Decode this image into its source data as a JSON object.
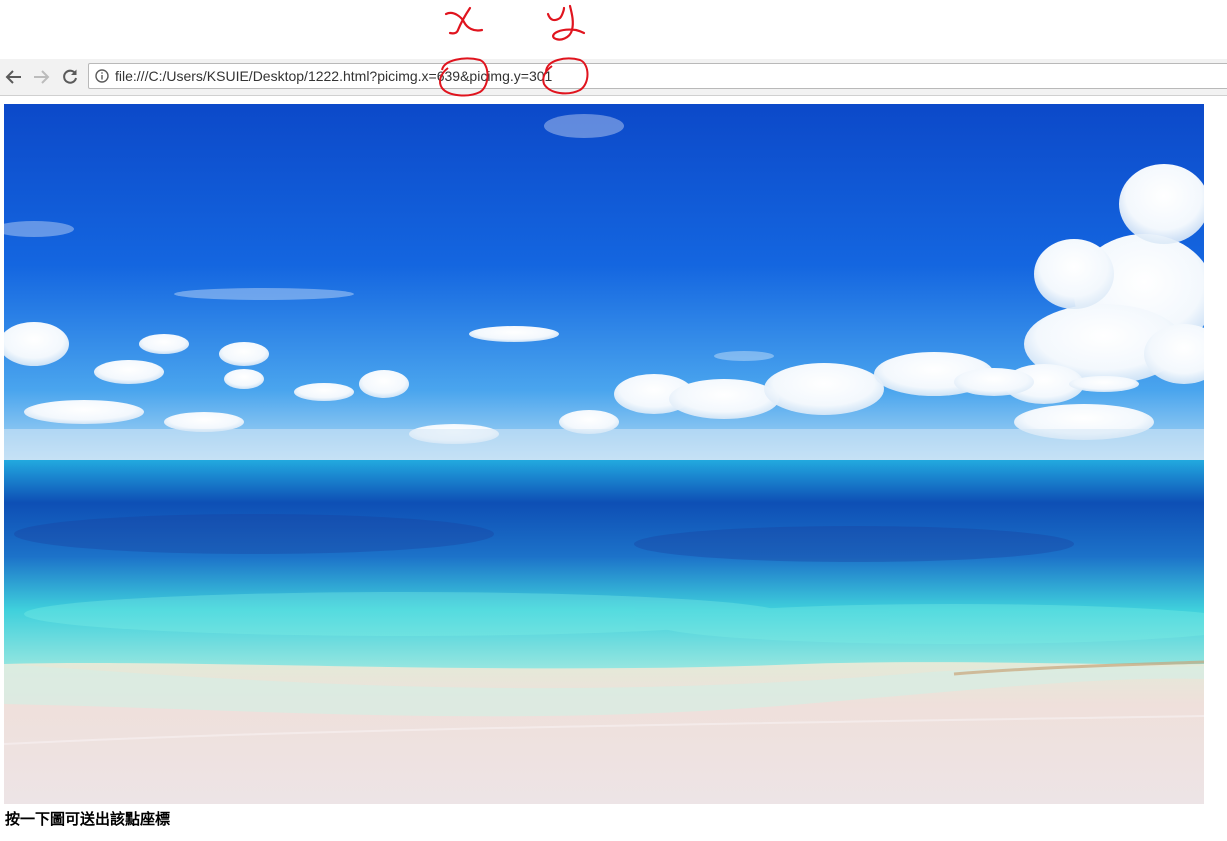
{
  "browser": {
    "back_icon": "arrow-left-icon",
    "forward_icon": "arrow-right-icon",
    "reload_icon": "reload-icon",
    "info_icon": "info-icon",
    "address": "file:///C:/Users/KSUIE/Desktop/1222.html?picimg.x=639&picimg.y=301"
  },
  "annotations": {
    "x_label": "x",
    "y_label": "y",
    "color": "#e0141e"
  },
  "page": {
    "image_description": "beach-sea-sky-photo",
    "caption": "按一下圖可送出該點座標"
  }
}
